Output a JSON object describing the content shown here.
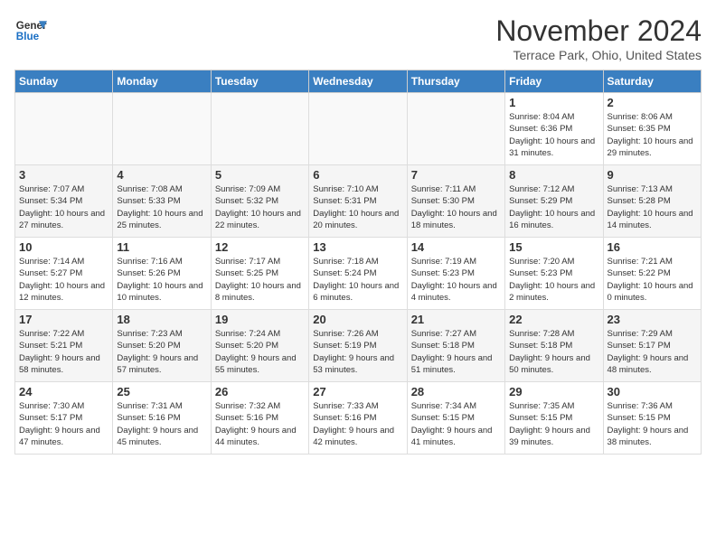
{
  "header": {
    "logo_line1": "General",
    "logo_line2": "Blue",
    "month": "November 2024",
    "location": "Terrace Park, Ohio, United States"
  },
  "days_of_week": [
    "Sunday",
    "Monday",
    "Tuesday",
    "Wednesday",
    "Thursday",
    "Friday",
    "Saturday"
  ],
  "weeks": [
    [
      {
        "day": "",
        "info": ""
      },
      {
        "day": "",
        "info": ""
      },
      {
        "day": "",
        "info": ""
      },
      {
        "day": "",
        "info": ""
      },
      {
        "day": "",
        "info": ""
      },
      {
        "day": "1",
        "info": "Sunrise: 8:04 AM\nSunset: 6:36 PM\nDaylight: 10 hours and 31 minutes."
      },
      {
        "day": "2",
        "info": "Sunrise: 8:06 AM\nSunset: 6:35 PM\nDaylight: 10 hours and 29 minutes."
      }
    ],
    [
      {
        "day": "3",
        "info": "Sunrise: 7:07 AM\nSunset: 5:34 PM\nDaylight: 10 hours and 27 minutes."
      },
      {
        "day": "4",
        "info": "Sunrise: 7:08 AM\nSunset: 5:33 PM\nDaylight: 10 hours and 25 minutes."
      },
      {
        "day": "5",
        "info": "Sunrise: 7:09 AM\nSunset: 5:32 PM\nDaylight: 10 hours and 22 minutes."
      },
      {
        "day": "6",
        "info": "Sunrise: 7:10 AM\nSunset: 5:31 PM\nDaylight: 10 hours and 20 minutes."
      },
      {
        "day": "7",
        "info": "Sunrise: 7:11 AM\nSunset: 5:30 PM\nDaylight: 10 hours and 18 minutes."
      },
      {
        "day": "8",
        "info": "Sunrise: 7:12 AM\nSunset: 5:29 PM\nDaylight: 10 hours and 16 minutes."
      },
      {
        "day": "9",
        "info": "Sunrise: 7:13 AM\nSunset: 5:28 PM\nDaylight: 10 hours and 14 minutes."
      }
    ],
    [
      {
        "day": "10",
        "info": "Sunrise: 7:14 AM\nSunset: 5:27 PM\nDaylight: 10 hours and 12 minutes."
      },
      {
        "day": "11",
        "info": "Sunrise: 7:16 AM\nSunset: 5:26 PM\nDaylight: 10 hours and 10 minutes."
      },
      {
        "day": "12",
        "info": "Sunrise: 7:17 AM\nSunset: 5:25 PM\nDaylight: 10 hours and 8 minutes."
      },
      {
        "day": "13",
        "info": "Sunrise: 7:18 AM\nSunset: 5:24 PM\nDaylight: 10 hours and 6 minutes."
      },
      {
        "day": "14",
        "info": "Sunrise: 7:19 AM\nSunset: 5:23 PM\nDaylight: 10 hours and 4 minutes."
      },
      {
        "day": "15",
        "info": "Sunrise: 7:20 AM\nSunset: 5:23 PM\nDaylight: 10 hours and 2 minutes."
      },
      {
        "day": "16",
        "info": "Sunrise: 7:21 AM\nSunset: 5:22 PM\nDaylight: 10 hours and 0 minutes."
      }
    ],
    [
      {
        "day": "17",
        "info": "Sunrise: 7:22 AM\nSunset: 5:21 PM\nDaylight: 9 hours and 58 minutes."
      },
      {
        "day": "18",
        "info": "Sunrise: 7:23 AM\nSunset: 5:20 PM\nDaylight: 9 hours and 57 minutes."
      },
      {
        "day": "19",
        "info": "Sunrise: 7:24 AM\nSunset: 5:20 PM\nDaylight: 9 hours and 55 minutes."
      },
      {
        "day": "20",
        "info": "Sunrise: 7:26 AM\nSunset: 5:19 PM\nDaylight: 9 hours and 53 minutes."
      },
      {
        "day": "21",
        "info": "Sunrise: 7:27 AM\nSunset: 5:18 PM\nDaylight: 9 hours and 51 minutes."
      },
      {
        "day": "22",
        "info": "Sunrise: 7:28 AM\nSunset: 5:18 PM\nDaylight: 9 hours and 50 minutes."
      },
      {
        "day": "23",
        "info": "Sunrise: 7:29 AM\nSunset: 5:17 PM\nDaylight: 9 hours and 48 minutes."
      }
    ],
    [
      {
        "day": "24",
        "info": "Sunrise: 7:30 AM\nSunset: 5:17 PM\nDaylight: 9 hours and 47 minutes."
      },
      {
        "day": "25",
        "info": "Sunrise: 7:31 AM\nSunset: 5:16 PM\nDaylight: 9 hours and 45 minutes."
      },
      {
        "day": "26",
        "info": "Sunrise: 7:32 AM\nSunset: 5:16 PM\nDaylight: 9 hours and 44 minutes."
      },
      {
        "day": "27",
        "info": "Sunrise: 7:33 AM\nSunset: 5:16 PM\nDaylight: 9 hours and 42 minutes."
      },
      {
        "day": "28",
        "info": "Sunrise: 7:34 AM\nSunset: 5:15 PM\nDaylight: 9 hours and 41 minutes."
      },
      {
        "day": "29",
        "info": "Sunrise: 7:35 AM\nSunset: 5:15 PM\nDaylight: 9 hours and 39 minutes."
      },
      {
        "day": "30",
        "info": "Sunrise: 7:36 AM\nSunset: 5:15 PM\nDaylight: 9 hours and 38 minutes."
      }
    ]
  ]
}
